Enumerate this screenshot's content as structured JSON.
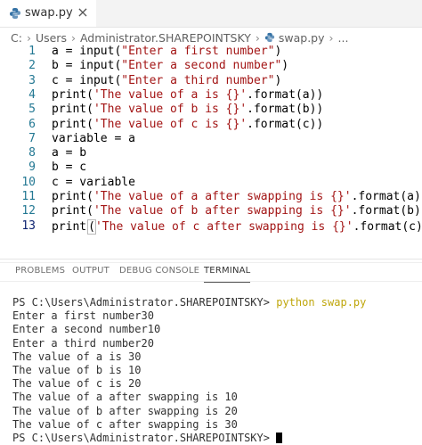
{
  "tab": {
    "filename": "swap.py",
    "close_glyph": "×"
  },
  "breadcrumb": [
    "C:",
    "Users",
    "Administrator.SHAREPOINTSKY",
    "swap.py",
    "..."
  ],
  "editor": {
    "lines": [
      {
        "n": "1",
        "parts": [
          [
            "a = input(",
            ""
          ],
          [
            "\"Enter a first number\"",
            "str"
          ],
          [
            ")",
            ""
          ]
        ]
      },
      {
        "n": "2",
        "parts": [
          [
            "b = input(",
            ""
          ],
          [
            "\"Enter a second number\"",
            "str"
          ],
          [
            ")",
            ""
          ]
        ]
      },
      {
        "n": "3",
        "parts": [
          [
            "c = input(",
            ""
          ],
          [
            "\"Enter a third number\"",
            "str"
          ],
          [
            ")",
            ""
          ]
        ]
      },
      {
        "n": "4",
        "parts": [
          [
            "print(",
            ""
          ],
          [
            "'The value of a is {}'",
            "str"
          ],
          [
            ".format(a))",
            ""
          ]
        ]
      },
      {
        "n": "5",
        "parts": [
          [
            "print(",
            ""
          ],
          [
            "'The value of b is {}'",
            "str"
          ],
          [
            ".format(b))",
            ""
          ]
        ]
      },
      {
        "n": "6",
        "parts": [
          [
            "print(",
            ""
          ],
          [
            "'The value of c is {}'",
            "str"
          ],
          [
            ".format(c))",
            ""
          ]
        ]
      },
      {
        "n": "7",
        "parts": [
          [
            "variable = a",
            ""
          ]
        ]
      },
      {
        "n": "8",
        "parts": [
          [
            "a = b",
            ""
          ]
        ]
      },
      {
        "n": "9",
        "parts": [
          [
            "b = c",
            ""
          ]
        ]
      },
      {
        "n": "10",
        "parts": [
          [
            "c = variable",
            ""
          ]
        ]
      },
      {
        "n": "11",
        "parts": [
          [
            "print(",
            ""
          ],
          [
            "'The value of a after swapping is {}'",
            "str"
          ],
          [
            ".format(a))",
            ""
          ]
        ]
      },
      {
        "n": "12",
        "parts": [
          [
            "print(",
            ""
          ],
          [
            "'The value of b after swapping is {}'",
            "str"
          ],
          [
            ".format(b))",
            ""
          ]
        ]
      },
      {
        "n": "13",
        "parts": [
          [
            "print",
            ""
          ],
          [
            "(",
            "bracket"
          ],
          [
            "'The value of c after swapping is {}'",
            "str"
          ],
          [
            ".format(c)",
            ""
          ],
          [
            ")",
            "bracket"
          ]
        ]
      }
    ]
  },
  "panel": {
    "tabs": [
      "PROBLEMS",
      "OUTPUT",
      "DEBUG CONSOLE",
      "TERMINAL"
    ],
    "active_tab": "TERMINAL"
  },
  "terminal": {
    "prompt": "PS C:\\Users\\Administrator.SHAREPOINTSKY> ",
    "command": "python swap.py",
    "output": [
      "Enter a first number30",
      "Enter a second number10",
      "Enter a third number20",
      "The value of a is 30",
      "The value of b is 10",
      "The value of c is 20",
      "The value of a after swapping is 10",
      "The value of b after swapping is 20",
      "The value of c after swapping is 30"
    ],
    "final_prompt": "PS C:\\Users\\Administrator.SHAREPOINTSKY> "
  },
  "colors": {
    "string": "#a31515",
    "line_number": "#237893",
    "terminal_command": "#bfa60b",
    "python_icon": "#3572a5"
  }
}
